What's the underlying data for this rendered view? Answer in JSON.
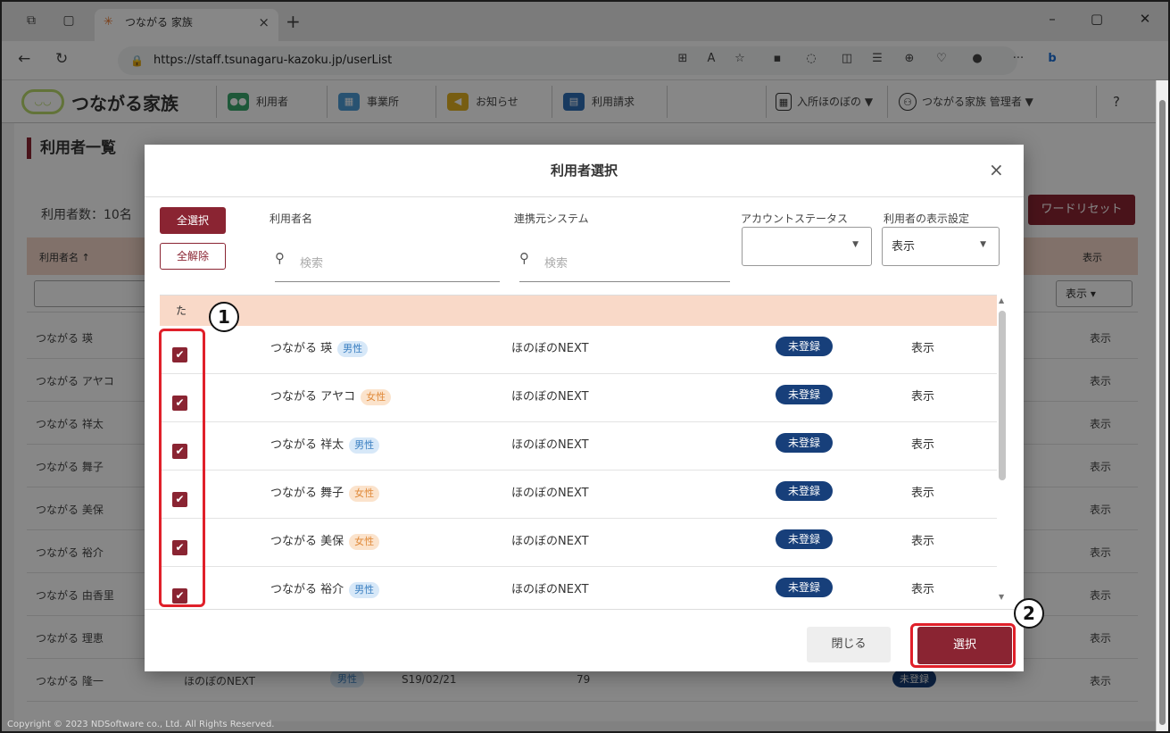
{
  "browser": {
    "tab_title": "つながる 家族",
    "url": "https://staff.tsunagaru-kazoku.jp/userList"
  },
  "app": {
    "logo_text": "つながる家族",
    "logo_mark": "◡◡",
    "menu": [
      {
        "label": "利用者",
        "icon": "users-icon"
      },
      {
        "label": "事業所",
        "icon": "building-icon"
      },
      {
        "label": "お知らせ",
        "icon": "megaphone-icon"
      },
      {
        "label": "利用請求",
        "icon": "document-icon"
      }
    ],
    "facility": "入所ほのぼの ▼",
    "account": "つながる家族 管理者 ▼",
    "help": "?"
  },
  "page": {
    "title": "利用者一覧",
    "user_count": "利用者数：10名",
    "password_reset": "ワードリセット",
    "col_name": "利用者名 ↑",
    "col_display": "表示",
    "filter_display": "表示",
    "rows": [
      {
        "name": "つながる 瑛",
        "display": "表示"
      },
      {
        "name": "つながる アヤコ",
        "display": "表示"
      },
      {
        "name": "つながる 祥太",
        "display": "表示"
      },
      {
        "name": "つながる 舞子",
        "display": "表示"
      },
      {
        "name": "つながる 美保",
        "display": "表示"
      },
      {
        "name": "つながる 裕介",
        "display": "表示"
      },
      {
        "name": "つながる 由香里",
        "display": "表示"
      },
      {
        "name": "つながる 理恵",
        "display": "表示"
      },
      {
        "name": "つながる 隆一",
        "display": "表示",
        "system": "ほのぼのNEXT",
        "gender": "男性",
        "birth": "S19/02/21",
        "age": "79",
        "status": "未登録"
      }
    ],
    "footer": "Copyright © 2023 NDSoftware co., Ltd. All Rights Reserved."
  },
  "modal": {
    "title": "利用者選択",
    "close": "×",
    "select_all": "全選択",
    "deselect_all": "全解除",
    "label_name": "利用者名",
    "label_system": "連携元システム",
    "label_account_status": "アカウントステータス",
    "label_display_setting": "利用者の表示設定",
    "search_placeholder": "検索",
    "account_status_value": "",
    "display_setting_value": "表示",
    "group": "た",
    "rows": [
      {
        "name": "つながる 瑛",
        "gender": "男性",
        "gender_type": "m",
        "system": "ほのぼのNEXT",
        "status": "未登録",
        "display": "表示",
        "checked": true
      },
      {
        "name": "つながる アヤコ",
        "gender": "女性",
        "gender_type": "f",
        "system": "ほのぼのNEXT",
        "status": "未登録",
        "display": "表示",
        "checked": true
      },
      {
        "name": "つながる 祥太",
        "gender": "男性",
        "gender_type": "m",
        "system": "ほのぼのNEXT",
        "status": "未登録",
        "display": "表示",
        "checked": true
      },
      {
        "name": "つながる 舞子",
        "gender": "女性",
        "gender_type": "f",
        "system": "ほのぼのNEXT",
        "status": "未登録",
        "display": "表示",
        "checked": true
      },
      {
        "name": "つながる 美保",
        "gender": "女性",
        "gender_type": "f",
        "system": "ほのぼのNEXT",
        "status": "未登録",
        "display": "表示",
        "checked": true
      },
      {
        "name": "つながる 裕介",
        "gender": "男性",
        "gender_type": "m",
        "system": "ほのぼのNEXT",
        "status": "未登録",
        "display": "表示",
        "checked": true
      }
    ],
    "btn_close": "閉じる",
    "btn_select": "選択"
  },
  "annotations": {
    "callout1": "1",
    "callout2": "2",
    "color": "#e0202a"
  },
  "colors": {
    "brand": "#8a2432",
    "status_badge": "#173f7a",
    "group_header": "#f9d9c8"
  }
}
